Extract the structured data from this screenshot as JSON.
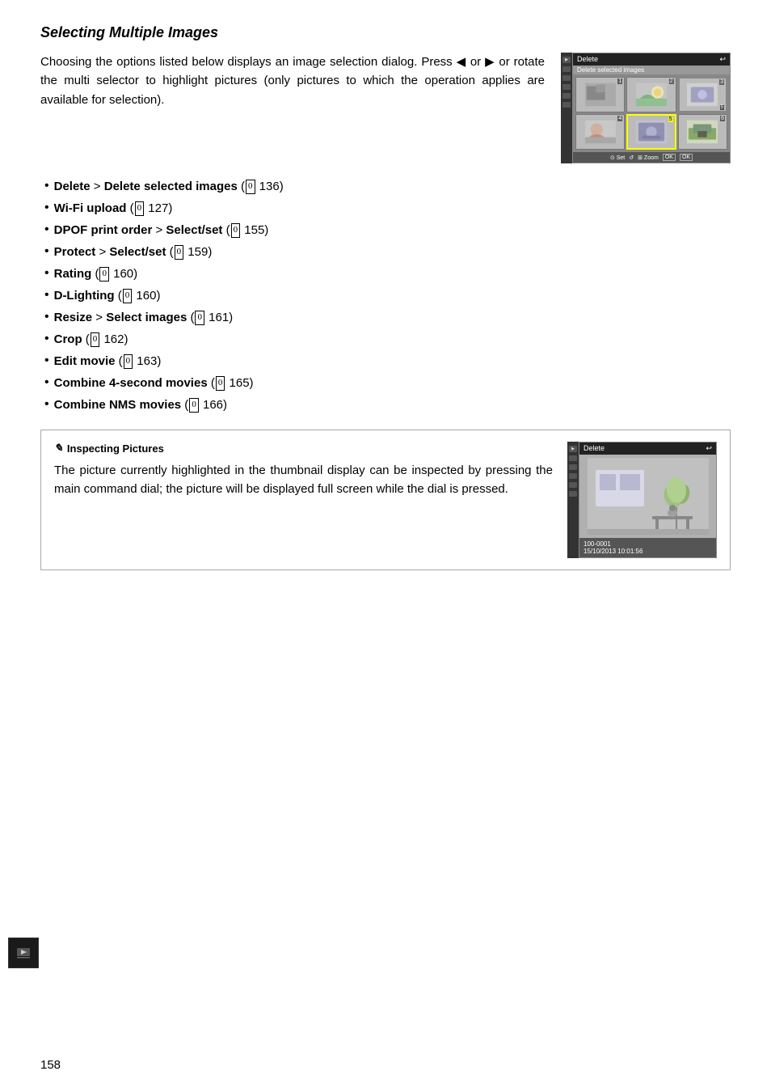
{
  "page": {
    "number": "158",
    "section_title": "Selecting Multiple Images",
    "intro": "Choosing the options listed below displays an image selection dialog. Press ◀ or ▶ or rotate the multi selector to highlight pictures (only pictures to which the operation applies are available for selection).",
    "bullets": [
      {
        "label": "Delete",
        "separator": " > ",
        "sub_label": "Delete selected images",
        "ref": "136"
      },
      {
        "label": "Wi-Fi upload",
        "separator": "",
        "sub_label": "",
        "ref": "127"
      },
      {
        "label": "DPOF print order",
        "separator": " > ",
        "sub_label": "Select/set",
        "ref": "155"
      },
      {
        "label": "Protect",
        "separator": " > ",
        "sub_label": "Select/set",
        "ref": "159"
      },
      {
        "label": "Rating",
        "separator": "",
        "sub_label": "",
        "ref": "160"
      },
      {
        "label": "D-Lighting",
        "separator": "",
        "sub_label": "",
        "ref": "160"
      },
      {
        "label": "Resize",
        "separator": " > ",
        "sub_label": "Select images",
        "ref": "161"
      },
      {
        "label": "Crop",
        "separator": "",
        "sub_label": "",
        "ref": "162"
      },
      {
        "label": "Edit movie",
        "separator": "",
        "sub_label": "",
        "ref": "163"
      },
      {
        "label": "Combine 4-second movies",
        "separator": "",
        "sub_label": "",
        "ref": "165"
      },
      {
        "label": "Combine NMS movies",
        "separator": "",
        "sub_label": "",
        "ref": "166"
      }
    ],
    "cam1": {
      "title": "Delete",
      "subtitle": "Delete selected images",
      "footer": "Set    Zoom OK OK"
    },
    "note": {
      "title": "Inspecting Pictures",
      "text": "The picture currently highlighted in the thumbnail display can be inspected by pressing the main command dial; the picture will be displayed full screen while the dial is pressed."
    },
    "cam2": {
      "title": "Delete",
      "file_info": "100-0001",
      "date": "15/10/2013  10:01:56"
    }
  }
}
